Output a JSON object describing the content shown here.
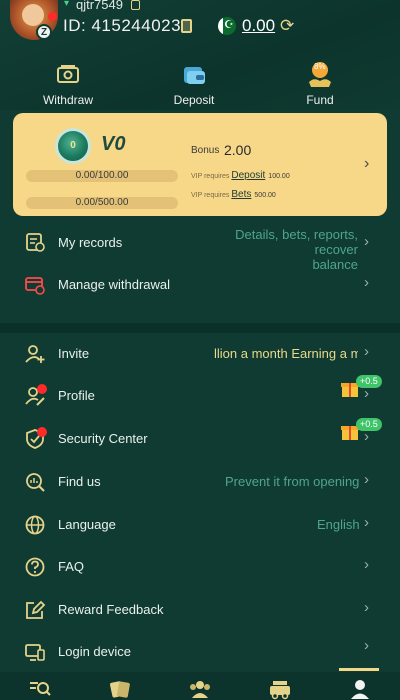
{
  "header": {
    "username": "qjtr7549",
    "uid_label": "ID:",
    "uid_value": "415244023",
    "balance": "0.00",
    "level_badge": "Z"
  },
  "quick_actions": [
    {
      "label": "Withdraw",
      "icon": "withdraw-icon"
    },
    {
      "label": "Deposit",
      "icon": "deposit-wallet-icon"
    },
    {
      "label": "Fund",
      "icon": "fund-icon",
      "badge": "8%"
    }
  ],
  "vip": {
    "level": "V0",
    "coin_text": "0",
    "progress_1": "0.00/100.00",
    "progress_2": "0.00/500.00",
    "bonus_label": "Bonus",
    "bonus_value": "2.00",
    "req_1_prefix": "VIP requires",
    "req_1_link": "Deposit",
    "req_1_value": "100.00",
    "req_2_prefix": "VIP requires",
    "req_2_link": "Bets",
    "req_2_value": "500.00"
  },
  "menu": {
    "records": {
      "label": "My records",
      "hint_line1": "Details, bets, reports, recover",
      "hint_line2": "balance"
    },
    "manage_withdrawal": {
      "label": "Manage withdrawal"
    },
    "invite": {
      "label": "Invite",
      "hint": "llion a month  Earning a m"
    },
    "profile": {
      "label": "Profile",
      "gift_badge": "+0.5"
    },
    "security": {
      "label": "Security Center",
      "gift_badge": "+0.5"
    },
    "find_us": {
      "label": "Find us",
      "hint": "Prevent it from opening"
    },
    "language": {
      "label": "Language",
      "hint": "English"
    },
    "faq": {
      "label": "FAQ"
    },
    "feedback": {
      "label": "Reward Feedback"
    },
    "login_device": {
      "label": "Login device"
    }
  },
  "colors": {
    "background": "#0f3b32",
    "accent_gold": "#f7d888",
    "hint_yellow": "#e8d88a",
    "hint_teal": "#4fa58c",
    "icon_gold": "#e6d38a",
    "alert_red": "#ff2a2a",
    "gift_green": "#3fc46a"
  },
  "bottom_nav": [
    {
      "icon": "search-home-icon"
    },
    {
      "icon": "cards-icon"
    },
    {
      "icon": "people-icon"
    },
    {
      "icon": "promo-car-icon"
    },
    {
      "icon": "person-icon",
      "active": true
    }
  ]
}
